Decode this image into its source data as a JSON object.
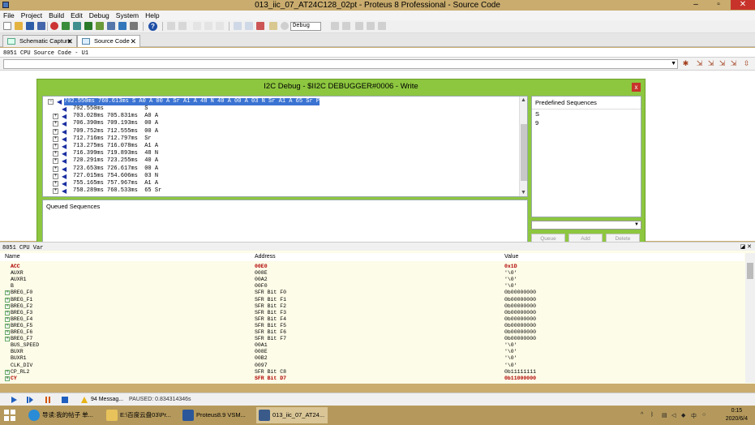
{
  "window": {
    "title": "013_iic_07_AT24C128_02pt - Proteus 8 Professional - Source Code"
  },
  "menu": [
    "File",
    "Project",
    "Build",
    "Edit",
    "Debug",
    "System",
    "Help"
  ],
  "toolbar": {
    "debug_combo": "Debug"
  },
  "tabs": [
    {
      "label": "Schematic Capture",
      "close": "✕"
    },
    {
      "label": "Source Code",
      "close": "✕"
    }
  ],
  "source": {
    "header": "8051 CPU Source Code - U1"
  },
  "dialog": {
    "title": "I2C Debug - $II2C DEBUGGER#0006 - Write",
    "close": "x",
    "tree": {
      "root": "702.550ms 760.613ms S A0 A 00 A Sr A1 A 48 N 40 A 00 A 03 N Sr A1 A 65 Sr P",
      "children": [
        "702.550ms            S",
        "703.028ms 705.831ms  A0 A",
        "706.390ms 709.193ms  00 A",
        "709.752ms 712.555ms  00 A",
        "712.716ms 712.797ms  Sr",
        "713.275ms 716.078ms  A1 A",
        "716.399ms 719.893ms  48 N",
        "720.291ms 723.255ms  40 A",
        "723.653ms 726.617ms  00 A",
        "727.015ms 754.606ms  03 N",
        "755.165ms 757.967ms  A1 A",
        "758.289ms 760.533ms  65 Sr"
      ]
    },
    "predefined": {
      "header": "Predefined Sequences",
      "items": [
        "S",
        "9"
      ]
    },
    "queued": {
      "header": "Queued Sequences"
    },
    "buttons": {
      "queue": "Queue",
      "add": "Add",
      "delete": "Delete"
    }
  },
  "variables": {
    "title": "8051 CPU Var",
    "columns": {
      "name": "Name",
      "address": "Address",
      "value": "Value"
    },
    "rows": [
      {
        "name": "ACC",
        "address": "00E0",
        "value": "0x1D",
        "red": true,
        "expand": false
      },
      {
        "name": "AUXR",
        "address": "008E",
        "value": "'\\0'",
        "red": false,
        "expand": false
      },
      {
        "name": "AUXR1",
        "address": "00A2",
        "value": "'\\0'",
        "red": false,
        "expand": false
      },
      {
        "name": "B",
        "address": "00F0",
        "value": "'\\0'",
        "red": false,
        "expand": false
      },
      {
        "name": "BREG_F0",
        "address": "SFR Bit F0",
        "value": "0b00000000",
        "red": false,
        "expand": true
      },
      {
        "name": "BREG_F1",
        "address": "SFR Bit F1",
        "value": "0b00000000",
        "red": false,
        "expand": true
      },
      {
        "name": "BREG_F2",
        "address": "SFR Bit F2",
        "value": "0b00000000",
        "red": false,
        "expand": true
      },
      {
        "name": "BREG_F3",
        "address": "SFR Bit F3",
        "value": "0b00000000",
        "red": false,
        "expand": true
      },
      {
        "name": "BREG_F4",
        "address": "SFR Bit F4",
        "value": "0b00000000",
        "red": false,
        "expand": true
      },
      {
        "name": "BREG_F5",
        "address": "SFR Bit F5",
        "value": "0b00000000",
        "red": false,
        "expand": true
      },
      {
        "name": "BREG_F6",
        "address": "SFR Bit F6",
        "value": "0b00000000",
        "red": false,
        "expand": true
      },
      {
        "name": "BREG_F7",
        "address": "SFR Bit F7",
        "value": "0b00000000",
        "red": false,
        "expand": true
      },
      {
        "name": "BUS_SPEED",
        "address": "00A1",
        "value": "'\\0'",
        "red": false,
        "expand": false
      },
      {
        "name": "BUXR",
        "address": "008E",
        "value": "'\\0'",
        "red": false,
        "expand": false
      },
      {
        "name": "BUXR1",
        "address": "00B2",
        "value": "'\\0'",
        "red": false,
        "expand": false
      },
      {
        "name": "CLK_DIV",
        "address": "0097",
        "value": "'\\0'",
        "red": false,
        "expand": false
      },
      {
        "name": "CP_RL2",
        "address": "SFR Bit C8",
        "value": "0b11111111",
        "red": false,
        "expand": true
      },
      {
        "name": "CY",
        "address": "SFR Bit D7",
        "value": "0b11000000",
        "red": true,
        "expand": true
      }
    ]
  },
  "status": {
    "messages": "94 Messag...",
    "paused": "PAUSED: 0.834314346s"
  },
  "taskbar": {
    "tasks": [
      "导读:我的帖子 单...",
      "E:\\百度云盘03\\Pr...",
      "Proteus8.9 VSM...",
      "013_iic_07_AT24..."
    ],
    "time": "0:15",
    "date": "2020/6/4",
    "ime": "中"
  },
  "colors": {
    "titlebar": "#c9ac6e",
    "dialog": "#8dc63f",
    "highlight": "#3b73d2",
    "var_red": "#b00000"
  }
}
